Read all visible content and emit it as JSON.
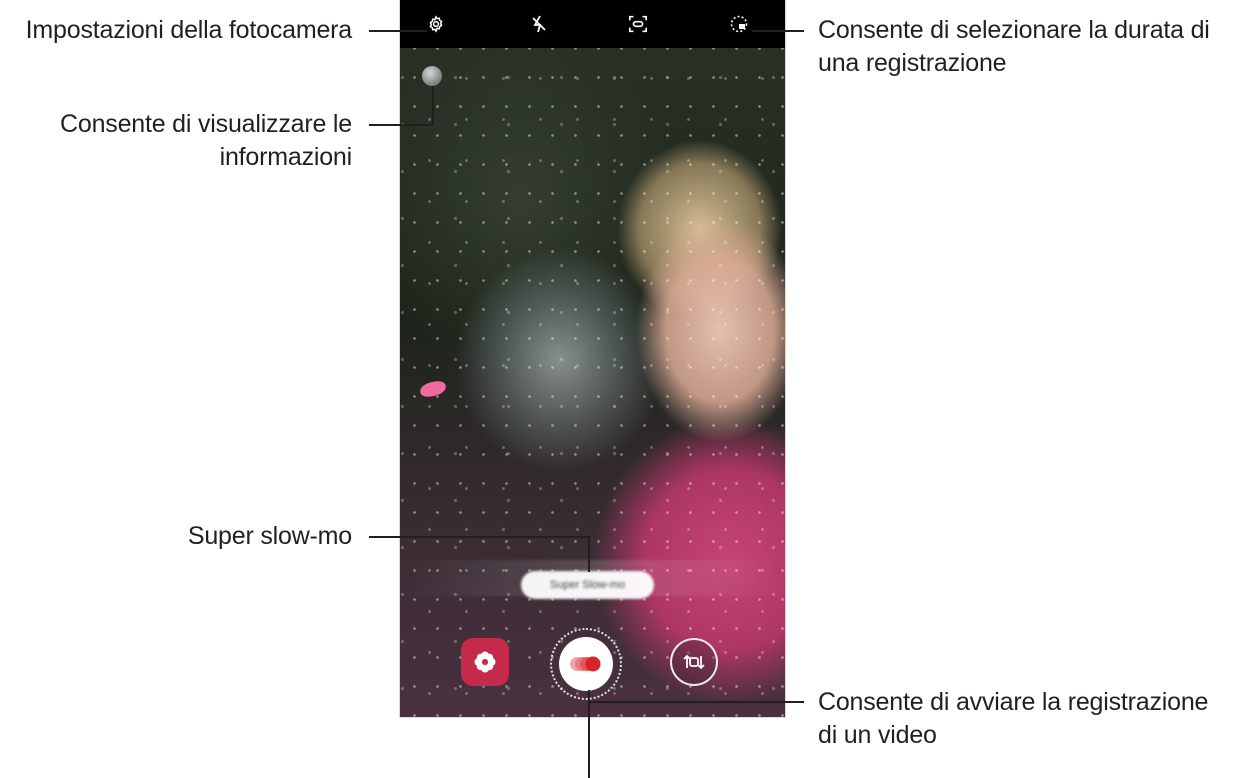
{
  "callouts": {
    "camera_settings": "Impostazioni della fotocamera",
    "view_info_line1": "Consente di visualizzare le",
    "view_info_line2": "informazioni",
    "duration_line1": "Consente di selezionare la durata di",
    "duration_line2": "una registrazione",
    "super_slowmo": "Super slow-mo",
    "start_record_line1": "Consente di avviare la registrazione",
    "start_record_line2": "di un video"
  },
  "camera": {
    "topbar_icons": [
      "gear-icon",
      "flash-off-icon",
      "motion-detection-icon",
      "duration-icon"
    ],
    "mode_pill": "Super Slow-mo",
    "bottom_controls": [
      "effects-icon",
      "super-slowmo-record-icon",
      "switch-camera-icon"
    ]
  },
  "colors": {
    "effect_button": "#c52a4a",
    "record_dots": "#d8232a",
    "text": "#231f20"
  }
}
